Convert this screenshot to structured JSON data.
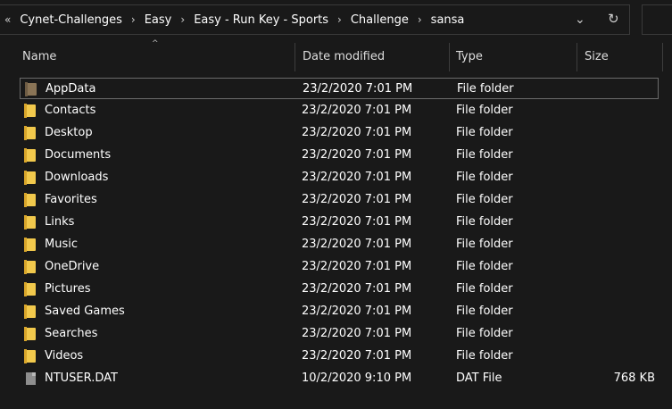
{
  "address": {
    "breadcrumbs": [
      "Cynet-Challenges",
      "Easy",
      "Easy - Run Key - Sports",
      "Challenge",
      "sansa"
    ],
    "separator": "›",
    "lead_glyph": "«",
    "dropdown_glyph": "⌄",
    "refresh_glyph": "↻"
  },
  "columns": {
    "name": "Name",
    "date": "Date modified",
    "type": "Type",
    "size": "Size",
    "sort_glyph": "^"
  },
  "files": [
    {
      "name": "AppData",
      "date": "23/2/2020 7:01 PM",
      "type": "File folder",
      "size": "",
      "icon": "folder-hidden-icon"
    },
    {
      "name": "Contacts",
      "date": "23/2/2020 7:01 PM",
      "type": "File folder",
      "size": "",
      "icon": "folder-icon"
    },
    {
      "name": "Desktop",
      "date": "23/2/2020 7:01 PM",
      "type": "File folder",
      "size": "",
      "icon": "folder-icon"
    },
    {
      "name": "Documents",
      "date": "23/2/2020 7:01 PM",
      "type": "File folder",
      "size": "",
      "icon": "folder-icon"
    },
    {
      "name": "Downloads",
      "date": "23/2/2020 7:01 PM",
      "type": "File folder",
      "size": "",
      "icon": "folder-icon"
    },
    {
      "name": "Favorites",
      "date": "23/2/2020 7:01 PM",
      "type": "File folder",
      "size": "",
      "icon": "folder-icon"
    },
    {
      "name": "Links",
      "date": "23/2/2020 7:01 PM",
      "type": "File folder",
      "size": "",
      "icon": "folder-icon"
    },
    {
      "name": "Music",
      "date": "23/2/2020 7:01 PM",
      "type": "File folder",
      "size": "",
      "icon": "folder-icon"
    },
    {
      "name": "OneDrive",
      "date": "23/2/2020 7:01 PM",
      "type": "File folder",
      "size": "",
      "icon": "folder-icon"
    },
    {
      "name": "Pictures",
      "date": "23/2/2020 7:01 PM",
      "type": "File folder",
      "size": "",
      "icon": "folder-icon"
    },
    {
      "name": "Saved Games",
      "date": "23/2/2020 7:01 PM",
      "type": "File folder",
      "size": "",
      "icon": "folder-icon"
    },
    {
      "name": "Searches",
      "date": "23/2/2020 7:01 PM",
      "type": "File folder",
      "size": "",
      "icon": "folder-icon"
    },
    {
      "name": "Videos",
      "date": "23/2/2020 7:01 PM",
      "type": "File folder",
      "size": "",
      "icon": "folder-icon"
    },
    {
      "name": "NTUSER.DAT",
      "date": "10/2/2020 9:10 PM",
      "type": "DAT File",
      "size": "768 KB",
      "icon": "file-icon"
    }
  ],
  "colors": {
    "background": "#191919",
    "folder": "#f2c94c",
    "hidden_folder": "#8a7456",
    "file": "#8e8e8e"
  }
}
